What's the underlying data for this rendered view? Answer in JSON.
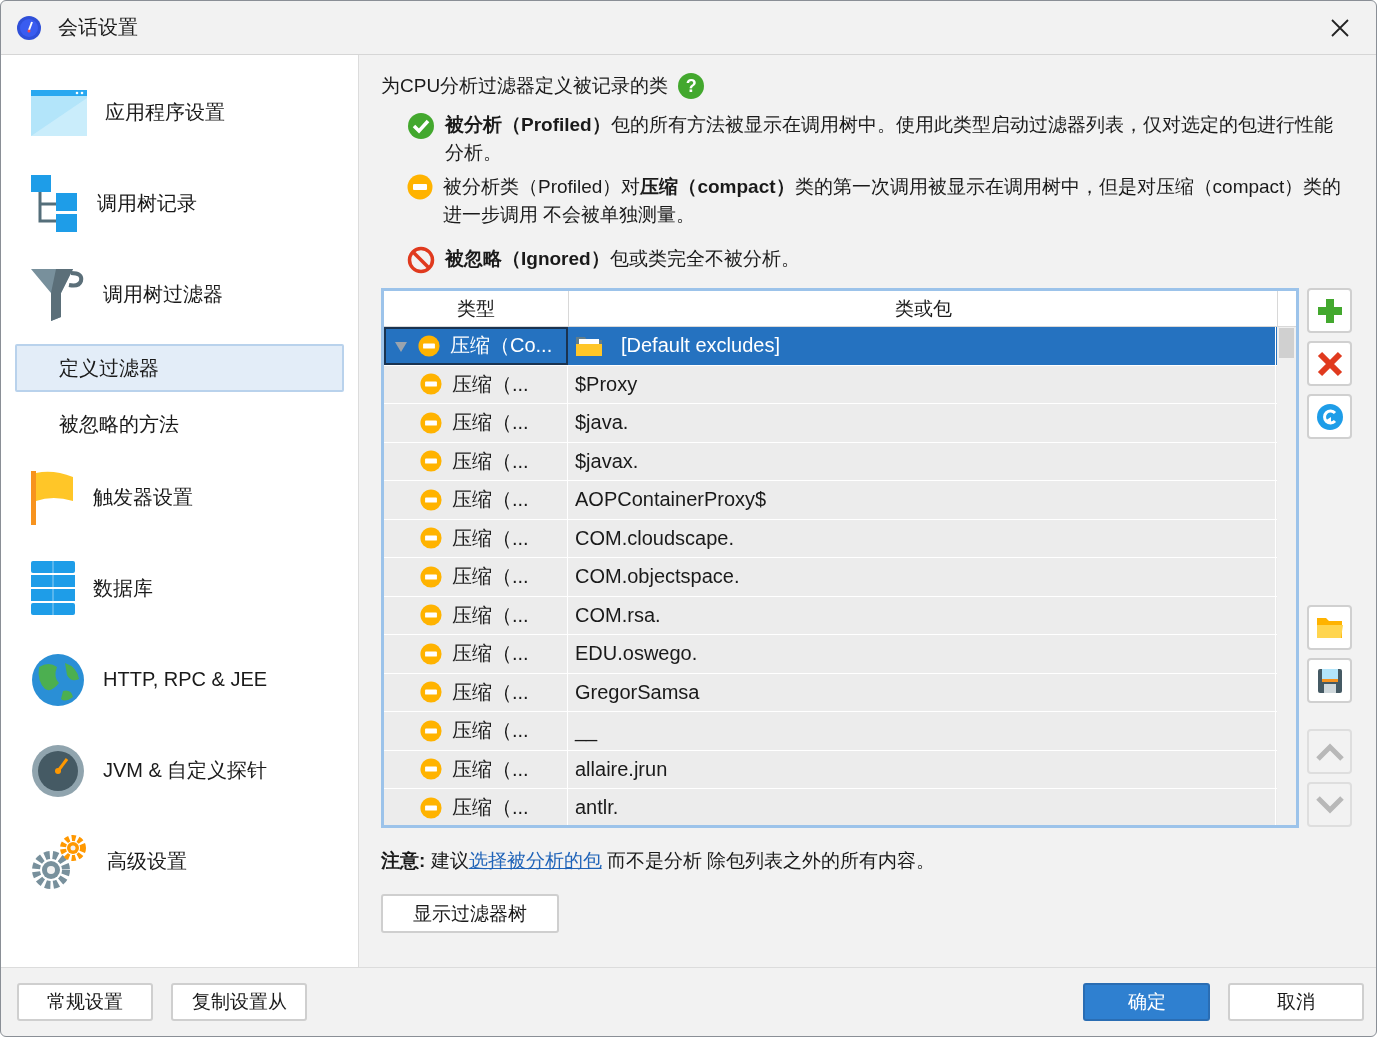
{
  "window": {
    "title": "会话设置"
  },
  "sidebar": {
    "items": [
      {
        "label": "应用程序设置",
        "kind": "main",
        "selected": false
      },
      {
        "label": "调用树记录",
        "kind": "main",
        "selected": false
      },
      {
        "label": "调用树过滤器",
        "kind": "main",
        "selected": false
      },
      {
        "label": "定义过滤器",
        "kind": "sub",
        "selected": true
      },
      {
        "label": "被忽略的方法",
        "kind": "sub",
        "selected": false
      },
      {
        "label": "触发器设置",
        "kind": "main",
        "selected": false
      },
      {
        "label": "数据库",
        "kind": "main",
        "selected": false
      },
      {
        "label": "HTTP, RPC & JEE",
        "kind": "main",
        "selected": false
      },
      {
        "label": "JVM & 自定义探针",
        "kind": "main",
        "selected": false
      },
      {
        "label": "高级设置",
        "kind": "main",
        "selected": false
      }
    ]
  },
  "heading": "为CPU分析过滤器定义被记录的类",
  "help_icon": "?",
  "legend": [
    {
      "kind": "profiled",
      "text": "**被分析（Profiled）**包的所有方法被显示在调用树中。使用此类型启动过滤器列表，仅对选定的包进行性能分析。"
    },
    {
      "kind": "compact",
      "text": "被分析类（Profiled）对**压缩（compact）**类的第一次调用被显示在调用树中，但是对压缩（compact）类的进一步调用 不会被单独测量。"
    },
    {
      "kind": "ignored",
      "text": "**被忽略（Ignored）**包或类完全不被分析。"
    }
  ],
  "table": {
    "columns": [
      "类型",
      "类或包"
    ],
    "rows": [
      {
        "kind": "compact",
        "type": "压缩（Co...",
        "value": "[Default excludes]",
        "selected": true,
        "expanded": true,
        "children": [
          {
            "kind": "compact",
            "type": "压缩（...",
            "value": "$Proxy",
            "selected": false
          },
          {
            "kind": "compact",
            "type": "压缩（...",
            "value": "$java.",
            "selected": false
          },
          {
            "kind": "compact",
            "type": "压缩（...",
            "value": "$javax.",
            "selected": false
          },
          {
            "kind": "compact",
            "type": "压缩（...",
            "value": "AOPContainerProxy$",
            "selected": false
          },
          {
            "kind": "compact",
            "type": "压缩（...",
            "value": "COM.cloudscape.",
            "selected": false
          },
          {
            "kind": "compact",
            "type": "压缩（...",
            "value": "COM.objectspace.",
            "selected": false
          },
          {
            "kind": "compact",
            "type": "压缩（...",
            "value": "COM.rsa.",
            "selected": false
          },
          {
            "kind": "compact",
            "type": "压缩（...",
            "value": "EDU.oswego.",
            "selected": false
          },
          {
            "kind": "compact",
            "type": "压缩（...",
            "value": "GregorSamsa",
            "selected": false
          },
          {
            "kind": "compact",
            "type": "压缩（...",
            "value": "__",
            "selected": false
          },
          {
            "kind": "compact",
            "type": "压缩（...",
            "value": "allaire.jrun",
            "selected": false
          },
          {
            "kind": "compact",
            "type": "压缩（...",
            "value": "antlr.",
            "selected": false
          }
        ]
      }
    ]
  },
  "tools": [
    {
      "kind": "add",
      "disabled": false
    },
    {
      "kind": "delete",
      "disabled": false
    },
    {
      "kind": "reset",
      "disabled": false
    },
    {
      "kind": "open",
      "disabled": false
    },
    {
      "kind": "save",
      "disabled": false
    },
    {
      "kind": "up",
      "disabled": true
    },
    {
      "kind": "down",
      "disabled": true
    }
  ],
  "note": {
    "prefix": "**注意:** 建议",
    "link": "选择被分析的包",
    "suffix": " 而不是分析 除包列表之外的所有内容。"
  },
  "show_tree_button": "显示过滤器树",
  "footer_buttons": [
    {
      "label": "常规设置",
      "kind": "normal"
    },
    {
      "label": "复制设置从",
      "kind": "normal"
    },
    {
      "label": "确定",
      "kind": "primary"
    },
    {
      "label": "取消",
      "kind": "normal"
    }
  ]
}
